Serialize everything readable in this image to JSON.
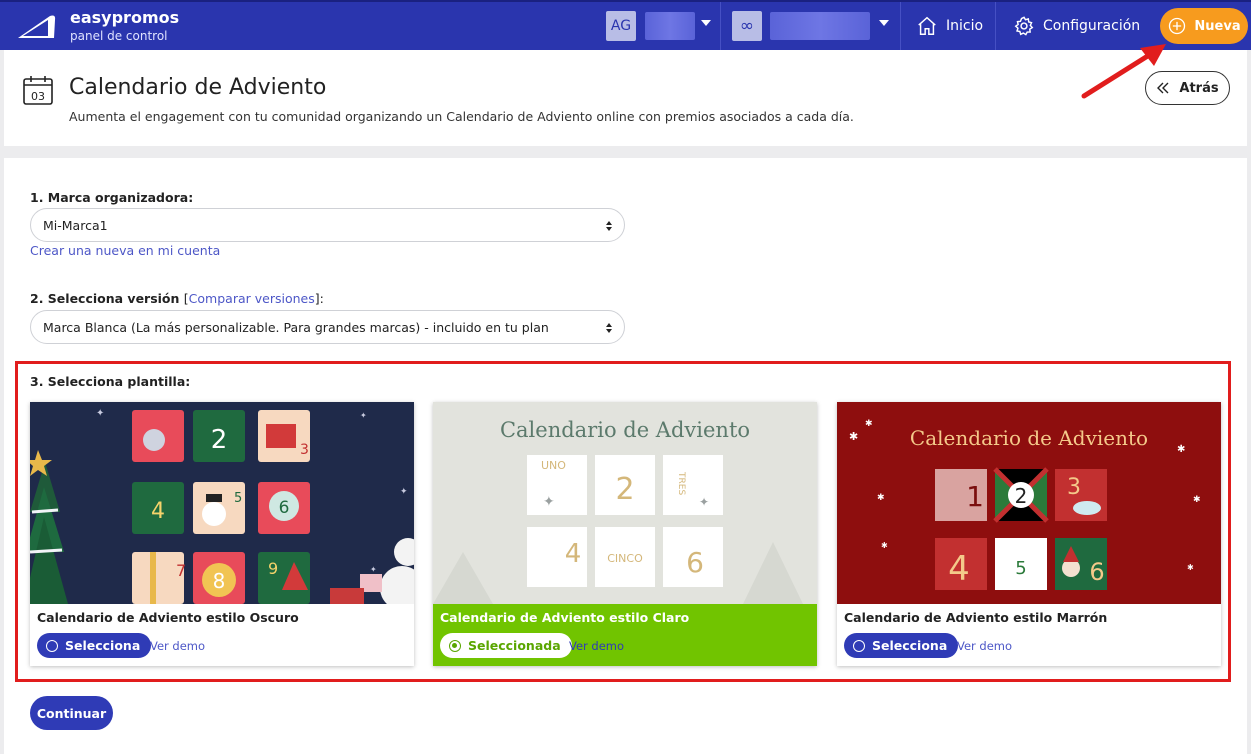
{
  "topbar": {
    "brand_name": "easypromos",
    "brand_sub": "panel de control",
    "user_initials": "AG",
    "org_symbol": "∞",
    "nav_home": "Inicio",
    "nav_config": "Configuración",
    "new_button": "Nueva"
  },
  "header": {
    "icon_day": "03",
    "title": "Calendario de Adviento",
    "description": "Aumenta el engagement con tu comunidad organizando un Calendario de Adviento online con premios asociados a cada día.",
    "back_button": "Atrás"
  },
  "form": {
    "brand_label": "1. Marca organizadora:",
    "brand_value": "Mi-Marca1",
    "brand_create_link": "Crear una nueva en mi cuenta",
    "version_label": "2. Selecciona versión",
    "version_compare_open": "[",
    "version_compare_link": "Comparar versiones",
    "version_compare_close": "]:",
    "version_value": "Marca Blanca (La más personalizable. Para grandes marcas) - incluido en tu plan",
    "template_label": "3. Selecciona plantilla:",
    "continue_button": "Continuar"
  },
  "templates": [
    {
      "name": "Calendario de Adviento estilo Oscuro",
      "select_label": "Selecciona",
      "demo_label": "Ver demo",
      "selected": false,
      "thumb_numbers": [
        "2",
        "3",
        "4",
        "5",
        "6",
        "7",
        "8",
        "9"
      ]
    },
    {
      "name": "Calendario de Adviento estilo Claro",
      "select_label": "Seleccionada",
      "demo_label": "Ver demo",
      "selected": true,
      "thumb_title": "Calendario de Adviento",
      "thumb_words": [
        "UNO",
        "2",
        "TRES",
        "4",
        "CINCO",
        "6"
      ]
    },
    {
      "name": "Calendario de Adviento estilo Marrón",
      "select_label": "Selecciona",
      "demo_label": "Ver demo",
      "selected": false,
      "thumb_title": "Calendario de Adviento",
      "thumb_numbers": [
        "1",
        "2",
        "3",
        "4",
        "5",
        "6"
      ]
    }
  ],
  "colors": {
    "topbar": "#2a35ae",
    "accent_orange": "#f79b1e",
    "primary_button": "#2f3bb6",
    "selected_green": "#71c400",
    "highlight_red": "#e11d1d"
  }
}
